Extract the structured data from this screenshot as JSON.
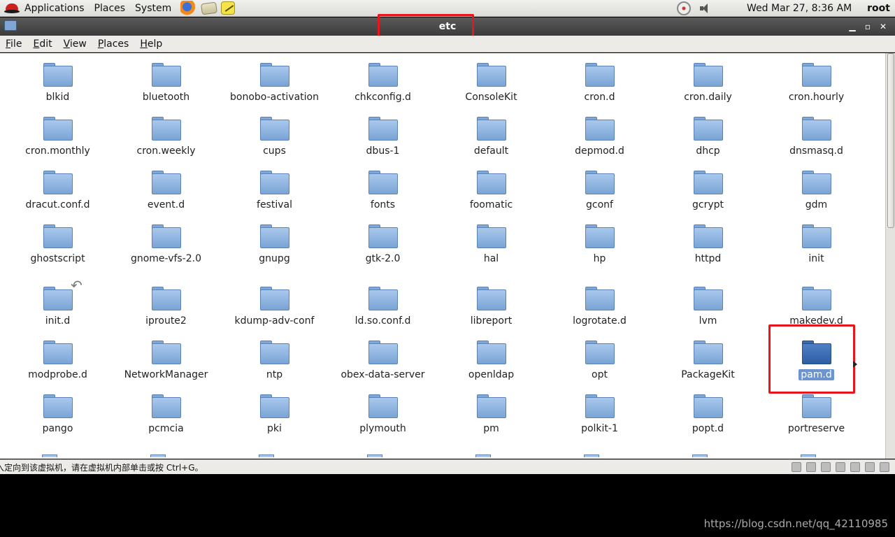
{
  "panel": {
    "applications": "Applications",
    "places": "Places",
    "system": "System",
    "clock": "Wed Mar 27,  8:36 AM",
    "user": "root"
  },
  "window": {
    "title": "etc"
  },
  "menubar": {
    "file": "File",
    "edit": "Edit",
    "view": "View",
    "places": "Places",
    "help": "Help"
  },
  "folders": [
    {
      "name": "blkid"
    },
    {
      "name": "bluetooth"
    },
    {
      "name": "bonobo-activation"
    },
    {
      "name": "chkconfig.d"
    },
    {
      "name": "ConsoleKit"
    },
    {
      "name": "cron.d"
    },
    {
      "name": "cron.daily"
    },
    {
      "name": "cron.hourly"
    },
    {
      "name": "cron.monthly"
    },
    {
      "name": "cron.weekly"
    },
    {
      "name": "cups"
    },
    {
      "name": "dbus-1"
    },
    {
      "name": "default"
    },
    {
      "name": "depmod.d"
    },
    {
      "name": "dhcp"
    },
    {
      "name": "dnsmasq.d"
    },
    {
      "name": "dracut.conf.d"
    },
    {
      "name": "event.d"
    },
    {
      "name": "festival"
    },
    {
      "name": "fonts"
    },
    {
      "name": "foomatic"
    },
    {
      "name": "gconf"
    },
    {
      "name": "gcrypt"
    },
    {
      "name": "gdm"
    },
    {
      "name": "ghostscript"
    },
    {
      "name": "gnome-vfs-2.0"
    },
    {
      "name": "gnupg"
    },
    {
      "name": "gtk-2.0"
    },
    {
      "name": "hal"
    },
    {
      "name": "hp"
    },
    {
      "name": "httpd"
    },
    {
      "name": "init"
    },
    {
      "name": "init.d",
      "link": true
    },
    {
      "name": "iproute2"
    },
    {
      "name": "kdump-adv-conf"
    },
    {
      "name": "ld.so.conf.d"
    },
    {
      "name": "libreport"
    },
    {
      "name": "logrotate.d"
    },
    {
      "name": "lvm"
    },
    {
      "name": "makedev.d"
    },
    {
      "name": "modprobe.d"
    },
    {
      "name": "NetworkManager"
    },
    {
      "name": "ntp"
    },
    {
      "name": "obex-data-server"
    },
    {
      "name": "openldap"
    },
    {
      "name": "opt"
    },
    {
      "name": "PackageKit"
    },
    {
      "name": "pam.d",
      "selected": true
    },
    {
      "name": "pango"
    },
    {
      "name": "pcmcia"
    },
    {
      "name": "pki"
    },
    {
      "name": "plymouth"
    },
    {
      "name": "pm"
    },
    {
      "name": "polkit-1"
    },
    {
      "name": "popt.d"
    },
    {
      "name": "portreserve"
    }
  ],
  "status": {
    "message": "入定向到该虚拟机，请在虚拟机内部单击或按 Ctrl+G。"
  },
  "watermark": "https://blog.csdn.net/qq_42110985",
  "colors": {
    "highlight_box": "#e8161b",
    "folder": "#7aa4d6",
    "selected_folder": "#2f5ea3"
  }
}
